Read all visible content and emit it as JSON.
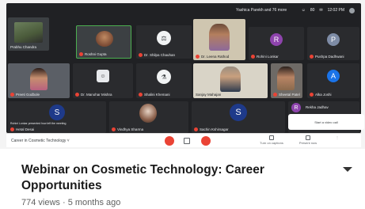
{
  "meeting": {
    "status_left": "Yashica Parekh and 76 more",
    "status_time": "12:02 PM",
    "participant_count": "80",
    "title": "Career in Cosmetic Technology",
    "controls": {
      "activity": "Turn on captions",
      "present": "Present now"
    },
    "join_popup": "Start a video call",
    "tiles": [
      {
        "name": "Prabhu Chandra",
        "mute": true,
        "kind": "photo"
      },
      {
        "name": "Roshni Gupta",
        "mute": true,
        "kind": "photo"
      },
      {
        "name": "Dr. Shilpa Chauhan",
        "mute": true,
        "kind": "icon"
      },
      {
        "name": "Dr. Leena Rathod",
        "mute": true,
        "kind": "photo"
      },
      {
        "name": "Rohini Lonkar",
        "mute": true,
        "kind": "avatar",
        "initial": "R",
        "color": "#8e44ad"
      },
      {
        "name": "Pushpa Dadhwani",
        "mute": true,
        "kind": "avatar",
        "initial": "P",
        "color": "#7e8ca6"
      },
      {
        "name": "Preeti Godbole",
        "mute": true,
        "kind": "photo"
      },
      {
        "name": "Dr. Manohar Mishra",
        "mute": true,
        "kind": "icon"
      },
      {
        "name": "Shalini Khemani",
        "mute": true,
        "kind": "icon"
      },
      {
        "name": "Sanjay Mahajan",
        "mute": false,
        "kind": "photo"
      },
      {
        "name": "Sheetal Patel",
        "mute": true,
        "kind": "photo"
      },
      {
        "name": "Alka Joshi",
        "mute": true,
        "kind": "avatar",
        "initial": "A",
        "color": "#1a73e8"
      },
      {
        "name": "Hetal Desai",
        "mute": true,
        "kind": "avatar",
        "initial": "S",
        "color": "#1e3a8a"
      },
      {
        "name": "Vindhya Sharma",
        "mute": true,
        "kind": "photo"
      },
      {
        "name": "Sachin Kshirsagar",
        "mute": true,
        "kind": "avatar",
        "initial": "S",
        "color": "#1e3a8a"
      },
      {
        "name": "Rekha Jadhav",
        "mute": true,
        "kind": "avatar",
        "initial": "R",
        "color": "#8e44ad"
      }
    ],
    "left_note": "Rohini Lonkar presented how left the meeting"
  },
  "video": {
    "title": "Webinar on Cosmetic Technology: Career Opportunities",
    "views": "774 views",
    "separator": " · ",
    "age": "5 months ago"
  },
  "colors": {
    "meet_bg": "#202124",
    "end_call": "#ea4335",
    "title_text": "#1a1a1a",
    "meta_text": "#606060"
  }
}
